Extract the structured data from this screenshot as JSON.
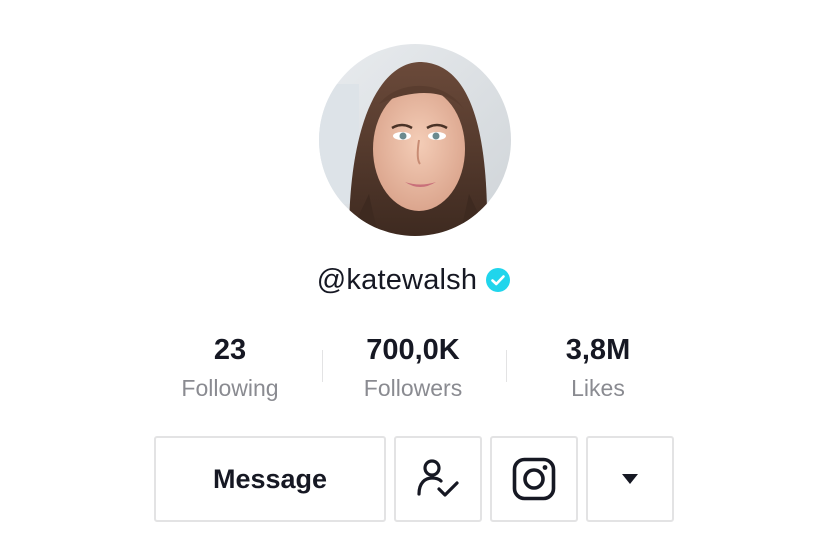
{
  "profile": {
    "username": "@kate walsh",
    "handle": "@katewalsh",
    "verified": true,
    "verified_color": "#20D5EC"
  },
  "stats": [
    {
      "value": "23",
      "label": "Following"
    },
    {
      "value": "700,0K",
      "label": "Followers"
    },
    {
      "value": "3,8M",
      "label": "Likes"
    }
  ],
  "actions": {
    "message_label": "Message",
    "follow_icon": "user-check-icon",
    "instagram_icon": "instagram-icon",
    "more_icon": "caret-down-icon"
  },
  "colors": {
    "text_primary": "#161823",
    "text_secondary": "#8a8b91",
    "border": "#e3e3e4"
  }
}
